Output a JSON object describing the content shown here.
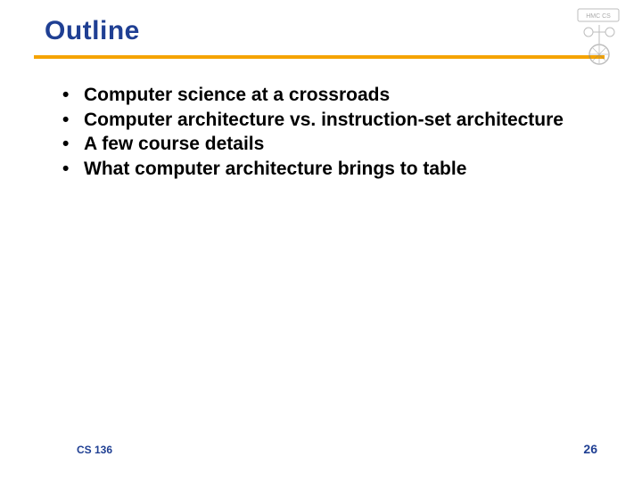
{
  "header": {
    "title": "Outline"
  },
  "bullets": [
    "Computer science at a crossroads",
    "Computer architecture vs. instruction-set architecture",
    "A few course details",
    "What computer architecture brings to table"
  ],
  "footer": {
    "course": "CS 136",
    "page": "26"
  }
}
